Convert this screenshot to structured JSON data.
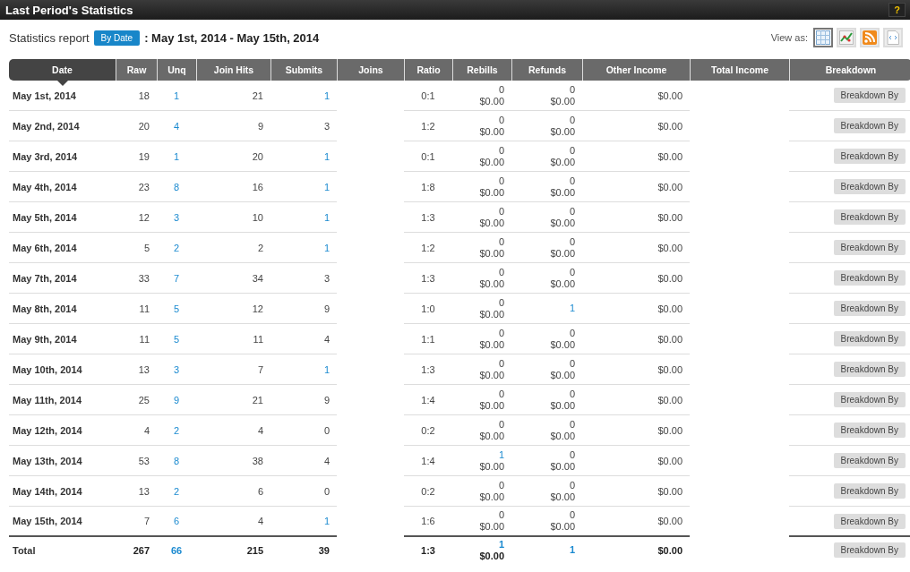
{
  "window": {
    "title": "Last Period's Statistics",
    "help": "?"
  },
  "report": {
    "label": "Statistics report",
    "mode_button": "By Date",
    "range": ": May 1st, 2014 - May 15th, 2014"
  },
  "view_as": {
    "label": "View as:",
    "options": [
      {
        "kind": "table",
        "selected": true
      },
      {
        "kind": "chart",
        "selected": false
      },
      {
        "kind": "rss",
        "selected": false
      },
      {
        "kind": "xml",
        "selected": false
      }
    ]
  },
  "table": {
    "columns": [
      {
        "label": "Date",
        "selected": true
      },
      {
        "label": "Raw",
        "selected": false
      },
      {
        "label": "Unq",
        "selected": false
      },
      {
        "label": "Join Hits",
        "selected": false
      },
      {
        "label": "Submits",
        "selected": false
      },
      {
        "label": "Joins",
        "selected": false
      },
      {
        "label": "Ratio",
        "selected": false
      },
      {
        "label": "Rebills",
        "selected": false
      },
      {
        "label": "Refunds",
        "selected": false
      },
      {
        "label": "Other Income",
        "selected": false
      },
      {
        "label": "Total Income",
        "selected": false
      },
      {
        "label": "Breakdown",
        "selected": false
      }
    ],
    "rows": [
      {
        "date": "May 1st, 2014",
        "raw": "18",
        "unq": "1",
        "join_hits": "21",
        "submits": "1",
        "submits_link": true,
        "ratio": "0:1",
        "rebills": {
          "count": "0",
          "amount": "$0.00",
          "link": false
        },
        "refunds": {
          "count": "0",
          "amount": "$0.00",
          "link": false
        },
        "other_income": "$0.00",
        "button": "Breakdown By"
      },
      {
        "date": "May 2nd, 2014",
        "raw": "20",
        "unq": "4",
        "join_hits": "9",
        "submits": "3",
        "submits_link": false,
        "ratio": "1:2",
        "rebills": {
          "count": "0",
          "amount": "$0.00",
          "link": false
        },
        "refunds": {
          "count": "0",
          "amount": "$0.00",
          "link": false
        },
        "other_income": "$0.00",
        "button": "Breakdown By"
      },
      {
        "date": "May 3rd, 2014",
        "raw": "19",
        "unq": "1",
        "join_hits": "20",
        "submits": "1",
        "submits_link": true,
        "ratio": "0:1",
        "rebills": {
          "count": "0",
          "amount": "$0.00",
          "link": false
        },
        "refunds": {
          "count": "0",
          "amount": "$0.00",
          "link": false
        },
        "other_income": "$0.00",
        "button": "Breakdown By"
      },
      {
        "date": "May 4th, 2014",
        "raw": "23",
        "unq": "8",
        "join_hits": "16",
        "submits": "1",
        "submits_link": true,
        "ratio": "1:8",
        "rebills": {
          "count": "0",
          "amount": "$0.00",
          "link": false
        },
        "refunds": {
          "count": "0",
          "amount": "$0.00",
          "link": false
        },
        "other_income": "$0.00",
        "button": "Breakdown By"
      },
      {
        "date": "May 5th, 2014",
        "raw": "12",
        "unq": "3",
        "join_hits": "10",
        "submits": "1",
        "submits_link": true,
        "ratio": "1:3",
        "rebills": {
          "count": "0",
          "amount": "$0.00",
          "link": false
        },
        "refunds": {
          "count": "0",
          "amount": "$0.00",
          "link": false
        },
        "other_income": "$0.00",
        "button": "Breakdown By"
      },
      {
        "date": "May 6th, 2014",
        "raw": "5",
        "unq": "2",
        "join_hits": "2",
        "submits": "1",
        "submits_link": true,
        "ratio": "1:2",
        "rebills": {
          "count": "0",
          "amount": "$0.00",
          "link": false
        },
        "refunds": {
          "count": "0",
          "amount": "$0.00",
          "link": false
        },
        "other_income": "$0.00",
        "button": "Breakdown By"
      },
      {
        "date": "May 7th, 2014",
        "raw": "33",
        "unq": "7",
        "join_hits": "34",
        "submits": "3",
        "submits_link": false,
        "ratio": "1:3",
        "rebills": {
          "count": "0",
          "amount": "$0.00",
          "link": false
        },
        "refunds": {
          "count": "0",
          "amount": "$0.00",
          "link": false
        },
        "other_income": "$0.00",
        "button": "Breakdown By"
      },
      {
        "date": "May 8th, 2014",
        "raw": "11",
        "unq": "5",
        "join_hits": "12",
        "submits": "9",
        "submits_link": false,
        "ratio": "1:0",
        "rebills": {
          "count": "0",
          "amount": "$0.00",
          "link": false
        },
        "refunds": {
          "count": "1",
          "link": true
        },
        "other_income": "$0.00",
        "button": "Breakdown By"
      },
      {
        "date": "May 9th, 2014",
        "raw": "11",
        "unq": "5",
        "join_hits": "11",
        "submits": "4",
        "submits_link": false,
        "ratio": "1:1",
        "rebills": {
          "count": "0",
          "amount": "$0.00",
          "link": false
        },
        "refunds": {
          "count": "0",
          "amount": "$0.00",
          "link": false
        },
        "other_income": "$0.00",
        "button": "Breakdown By"
      },
      {
        "date": "May 10th, 2014",
        "raw": "13",
        "unq": "3",
        "join_hits": "7",
        "submits": "1",
        "submits_link": true,
        "ratio": "1:3",
        "rebills": {
          "count": "0",
          "amount": "$0.00",
          "link": false
        },
        "refunds": {
          "count": "0",
          "amount": "$0.00",
          "link": false
        },
        "other_income": "$0.00",
        "button": "Breakdown By"
      },
      {
        "date": "May 11th, 2014",
        "raw": "25",
        "unq": "9",
        "join_hits": "21",
        "submits": "9",
        "submits_link": false,
        "ratio": "1:4",
        "rebills": {
          "count": "0",
          "amount": "$0.00",
          "link": false
        },
        "refunds": {
          "count": "0",
          "amount": "$0.00",
          "link": false
        },
        "other_income": "$0.00",
        "button": "Breakdown By"
      },
      {
        "date": "May 12th, 2014",
        "raw": "4",
        "unq": "2",
        "join_hits": "4",
        "submits": "0",
        "submits_link": false,
        "ratio": "0:2",
        "rebills": {
          "count": "0",
          "amount": "$0.00",
          "link": false
        },
        "refunds": {
          "count": "0",
          "amount": "$0.00",
          "link": false
        },
        "other_income": "$0.00",
        "button": "Breakdown By"
      },
      {
        "date": "May 13th, 2014",
        "raw": "53",
        "unq": "8",
        "join_hits": "38",
        "submits": "4",
        "submits_link": false,
        "ratio": "1:4",
        "rebills": {
          "count": "1",
          "amount": "$0.00",
          "link": true
        },
        "refunds": {
          "count": "0",
          "amount": "$0.00",
          "link": false
        },
        "other_income": "$0.00",
        "button": "Breakdown By"
      },
      {
        "date": "May 14th, 2014",
        "raw": "13",
        "unq": "2",
        "join_hits": "6",
        "submits": "0",
        "submits_link": false,
        "ratio": "0:2",
        "rebills": {
          "count": "0",
          "amount": "$0.00",
          "link": false
        },
        "refunds": {
          "count": "0",
          "amount": "$0.00",
          "link": false
        },
        "other_income": "$0.00",
        "button": "Breakdown By"
      },
      {
        "date": "May 15th, 2014",
        "raw": "7",
        "unq": "6",
        "join_hits": "4",
        "submits": "1",
        "submits_link": true,
        "ratio": "1:6",
        "rebills": {
          "count": "0",
          "amount": "$0.00",
          "link": false
        },
        "refunds": {
          "count": "0",
          "amount": "$0.00",
          "link": false
        },
        "other_income": "$0.00",
        "button": "Breakdown By"
      }
    ],
    "total": {
      "date": "Total",
      "raw": "267",
      "unq": "66",
      "join_hits": "215",
      "submits": "39",
      "submits_link": false,
      "ratio": "1:3",
      "rebills": {
        "count": "1",
        "amount": "$0.00",
        "link": true
      },
      "refunds": {
        "count": "1",
        "link": true
      },
      "other_income": "$0.00",
      "button": "Breakdown By"
    }
  }
}
